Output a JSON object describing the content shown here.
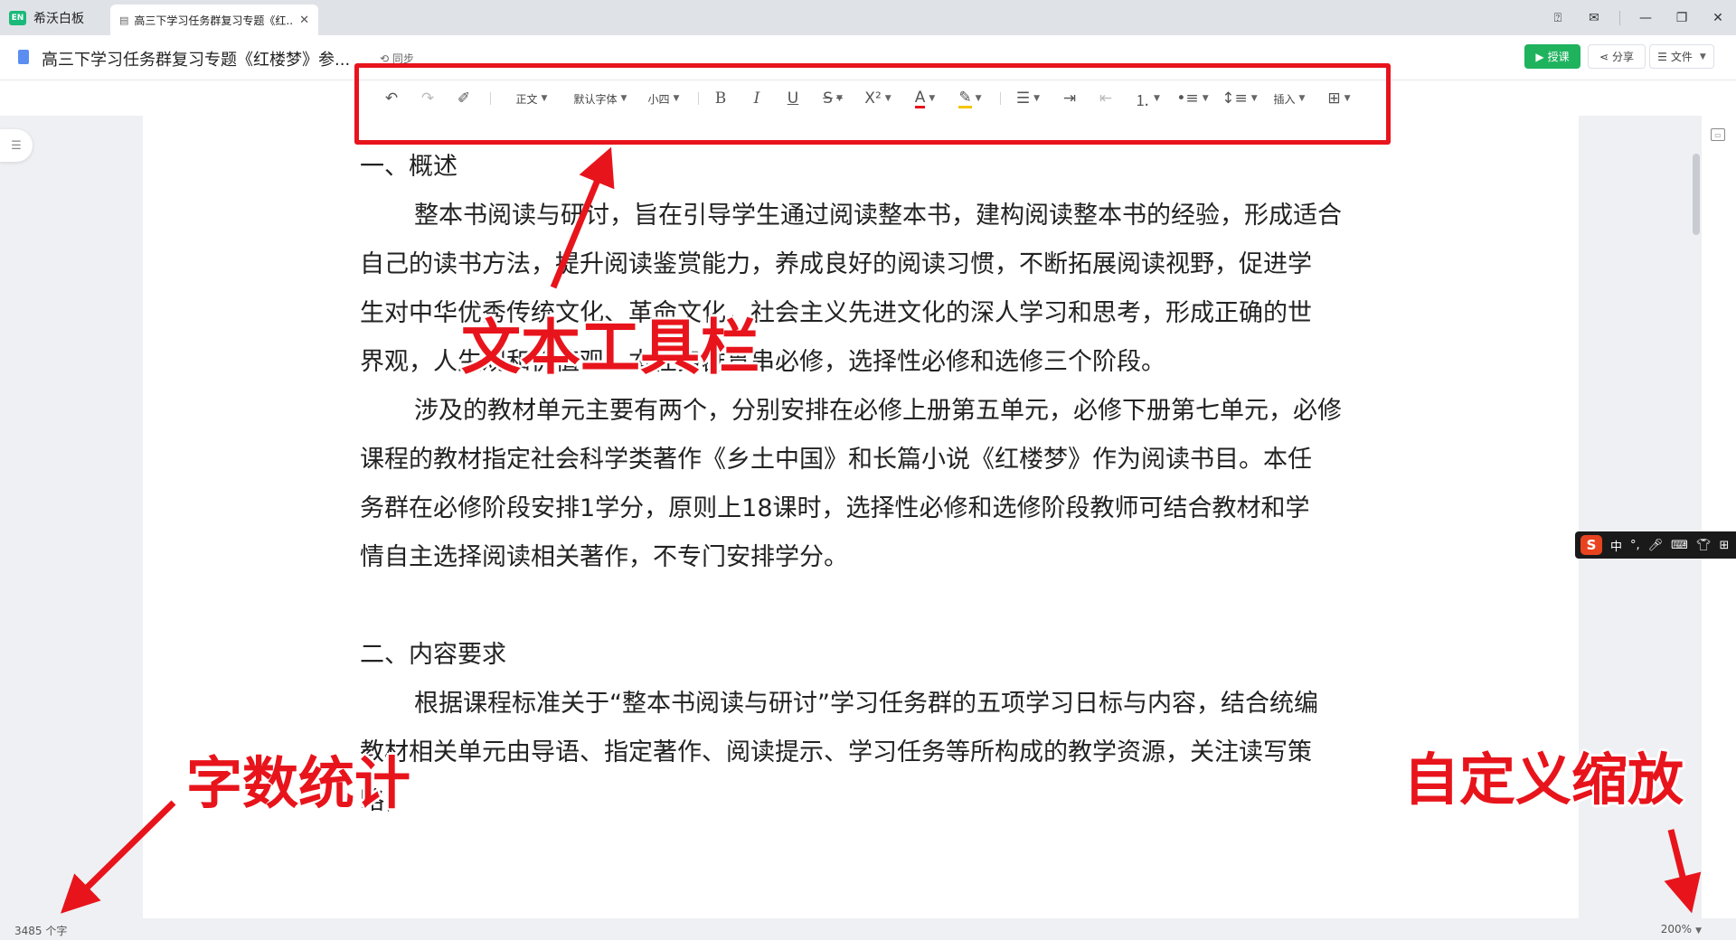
{
  "tabs": {
    "app_name": "希沃白板",
    "doc_tab_title": "高三下学习任务群复习专题《红..."
  },
  "header": {
    "doc_title": "高三下学习任务群复习专题《红楼梦》参...",
    "history_label": "同步",
    "lesson_button": "授课",
    "share_button": "分享",
    "file_button": "文件"
  },
  "toolbar": {
    "para_style": "正文",
    "font_family": "默认字体",
    "font_size": "小四",
    "insert": "插入"
  },
  "document": {
    "heading1": "一、概述",
    "p1_line1": "整本书阅读与研讨，旨在引导学生通过阅读整本书，建构阅读整本书的经验，形成适合",
    "p1_line2": "自己的读书方法，提升阅读鉴赏能力，养成良好的阅读习惯，不断拓展阅读视野，促进学",
    "p1_line3": "生对中华优秀传统文化、革命文化，社会主义先进文化的深人学习和思考，形成正确的世",
    "p1_line4": "界观，人生观和价值观。本任务群贯串必修，选择性必修和选修三个阶段。",
    "p2_line1": "涉及的教材单元主要有两个，分别安排在必修上册第五单元，必修下册第七单元，必修",
    "p2_line2": "课程的教材指定社会科学类著作《乡土中国》和长篇小说《红楼梦》作为阅读书目。本任",
    "p2_line3": "务群在必修阶段安排1学分，原则上18课时，选择性必修和选修阶段教师可结合教材和学",
    "p2_line4": "情自主选择阅读相关著作，不专门安排学分。",
    "heading2": "二、内容要求",
    "p3_line1": "根据课程标准关于“整本书阅读与研讨”学习任务群的五项学习日标与内容，结合统编",
    "p3_line2": "教材相关单元由导语、指定著作、阅读提示、学习任务等所构成的教学资源，关注读写策",
    "p3_line3": "略，"
  },
  "ime": {
    "logo": "S",
    "lang": "中"
  },
  "status": {
    "word_count": "3485 个字",
    "zoom": "200%"
  },
  "annotations": {
    "toolbar_label": "文本工具栏",
    "wordcount_label": "字数统计",
    "zoom_label": "自定义缩放"
  },
  "colors": {
    "accent_green": "#1fb35e",
    "annotation_red": "#e8141c"
  }
}
